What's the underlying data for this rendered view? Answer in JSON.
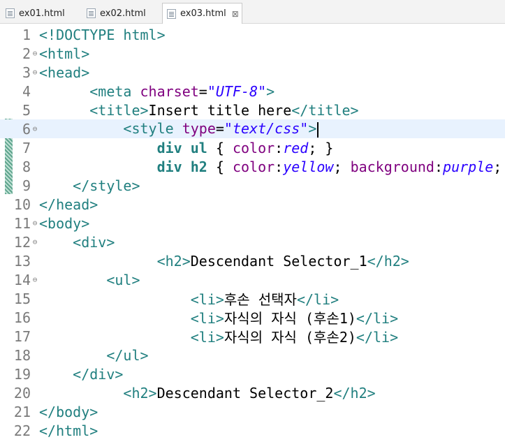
{
  "tabs": [
    {
      "label": "ex01.html",
      "active": false
    },
    {
      "label": "ex02.html",
      "active": false
    },
    {
      "label": "ex03.html",
      "active": true,
      "close": "⊠"
    }
  ],
  "lines": [
    {
      "n": "1",
      "text": [
        "<!DOCTYPE html>"
      ]
    },
    {
      "n": "2",
      "text": [
        "<html>"
      ]
    },
    {
      "n": "3",
      "text": [
        "<head>"
      ]
    },
    {
      "n": "4",
      "text": [
        "<meta ",
        "charset",
        "=",
        "\"UTF-8\"",
        ">"
      ]
    },
    {
      "n": "5",
      "text": [
        "<title>",
        "Insert title here",
        "</title>"
      ]
    },
    {
      "n": "6",
      "text": [
        "    <style ",
        "type",
        "=",
        "\"text/css\"",
        ">"
      ]
    },
    {
      "n": "7",
      "text": [
        "        div ul",
        " { ",
        "color",
        ":",
        "red",
        "; }"
      ]
    },
    {
      "n": "8",
      "text": [
        "        div h2",
        " { ",
        "color",
        ":",
        "yellow",
        "; ",
        "background",
        ":",
        "purple",
        "; }"
      ]
    },
    {
      "n": "9",
      "text": [
        "    </style>"
      ]
    },
    {
      "n": "10",
      "text": [
        "</head>"
      ]
    },
    {
      "n": "11",
      "text": [
        "<body>"
      ]
    },
    {
      "n": "12",
      "text": [
        "    <div>"
      ]
    },
    {
      "n": "13",
      "text": [
        "        <h2>",
        "Descendant Selector_1",
        "</h2>"
      ]
    },
    {
      "n": "14",
      "text": [
        "        <ul>"
      ]
    },
    {
      "n": "15",
      "text": [
        "            <li>",
        "후손 선택자",
        "</li>"
      ]
    },
    {
      "n": "16",
      "text": [
        "            <li>",
        "자식의 자식 (후손1)",
        "</li>"
      ]
    },
    {
      "n": "17",
      "text": [
        "            <li>",
        "자식의 자식 (후손2)",
        "</li>"
      ]
    },
    {
      "n": "18",
      "text": [
        "        </ul>"
      ]
    },
    {
      "n": "19",
      "text": [
        "    </div>"
      ]
    },
    {
      "n": "20",
      "text": [
        "    <h2>",
        "Descendant Selector_2",
        "</h2>"
      ]
    },
    {
      "n": "21",
      "text": [
        "</body>"
      ]
    },
    {
      "n": "22",
      "text": [
        "</html>"
      ]
    }
  ],
  "fold_marker": "⊖",
  "colors": {
    "tag": "#207f7f",
    "attribute": "#7f007f",
    "value": "#2a00ff",
    "current_line": "#e8f2fe"
  }
}
